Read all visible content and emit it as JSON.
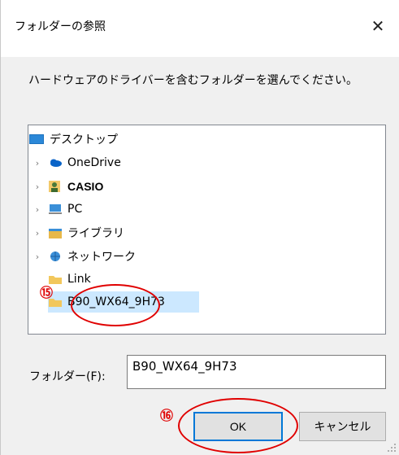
{
  "window": {
    "title": "フォルダーの参照",
    "close_glyph": "✕"
  },
  "description": "ハードウェアのドライバーを含むフォルダーを選んでください。",
  "tree": {
    "items": [
      {
        "label": "デスクトップ",
        "icon": "desktop-icon"
      },
      {
        "label": "OneDrive",
        "icon": "cloud-icon"
      },
      {
        "label": "CASIO",
        "icon": "user-icon"
      },
      {
        "label": "PC",
        "icon": "computer-icon"
      },
      {
        "label": "ライブラリ",
        "icon": "library-icon"
      },
      {
        "label": "ネットワーク",
        "icon": "network-icon"
      },
      {
        "label": "Link",
        "icon": "folder-icon"
      },
      {
        "label": "B90_WX64_9H73",
        "icon": "folder-icon"
      }
    ],
    "expander_glyph": "›"
  },
  "folder_field": {
    "label": "フォルダー(F):",
    "value": "B90_WX64_9H73"
  },
  "buttons": {
    "ok": "OK",
    "cancel": "キャンセル"
  },
  "callouts": {
    "step15": "⑮",
    "step16": "⑯"
  },
  "colors": {
    "accent": "#0078d7",
    "selection": "#cce8ff",
    "callout": "#e00000"
  }
}
